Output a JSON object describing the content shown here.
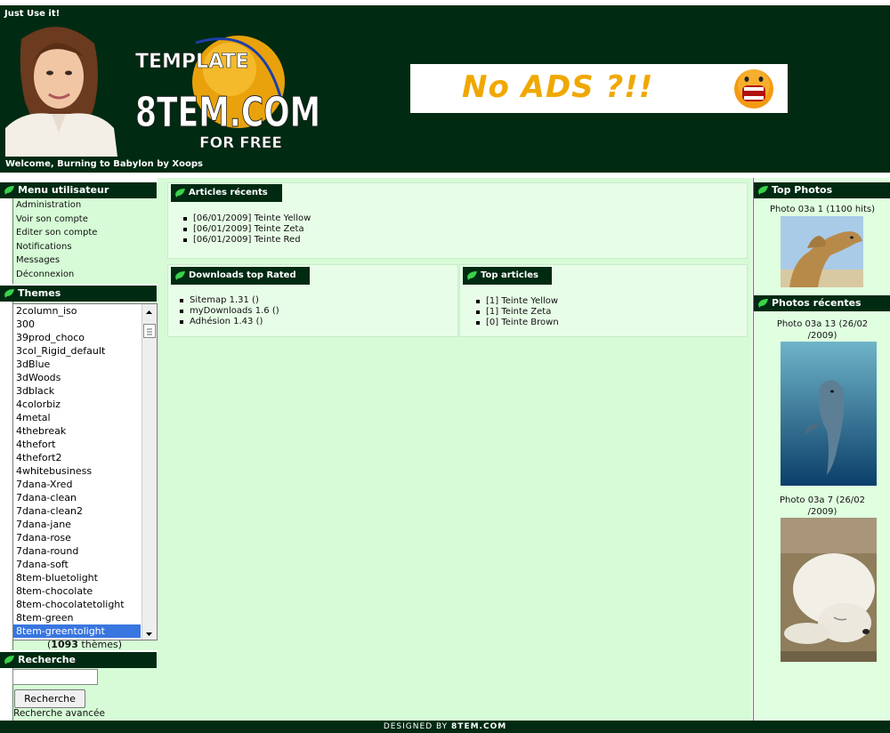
{
  "header": {
    "tagline": "Just Use it!",
    "welcome": "Welcome, Burning to Babylon by Xoops",
    "logo_top": "TEMPLATE",
    "logo_main": "8TEM.COM",
    "logo_bottom": "FOR FREE",
    "ad_text": "No ADS ?!!"
  },
  "left": {
    "menu_title": "Menu utilisateur",
    "menu_items": [
      "Administration",
      "Voir son compte",
      "Editer son compte",
      "Notifications",
      "Messages",
      "Déconnexion"
    ],
    "themes_title": "Themes",
    "themes": [
      "2column_iso",
      "300",
      "39prod_choco",
      "3col_Rigid_default",
      "3dBlue",
      "3dWoods",
      "3dblack",
      "4colorbiz",
      "4metal",
      "4thebreak",
      "4thefort",
      "4thefort2",
      "4whitebusiness",
      "7dana-Xred",
      "7dana-clean",
      "7dana-clean2",
      "7dana-jane",
      "7dana-rose",
      "7dana-round",
      "7dana-soft",
      "8tem-bluetolight",
      "8tem-chocolate",
      "8tem-chocolatetolight",
      "8tem-green",
      "8tem-greentolight"
    ],
    "themes_count_open": "(",
    "themes_count": "1093",
    "themes_count_label": "thèmes)",
    "search_title": "Recherche",
    "search_button": "Recherche",
    "search_advanced": "Recherche avancée",
    "search_value": ""
  },
  "center": {
    "articles_title": "Articles récents",
    "articles": [
      "[06/01/2009] Teinte Yellow",
      "[06/01/2009] Teinte Zeta",
      "[06/01/2009] Teinte Red"
    ],
    "downloads_title": "Downloads top Rated",
    "downloads": [
      "Sitemap 1.31 ()",
      "myDownloads 1.6 ()",
      "Adhésion 1.43 ()"
    ],
    "top_articles_title": "Top articles",
    "top_articles": [
      "[1] Teinte Yellow",
      "[1] Teinte Zeta",
      "[0] Teinte Brown"
    ]
  },
  "right": {
    "top_photos_title": "Top Photos",
    "top_photo_caption": "Photo 03a 1 (1100 hits)",
    "recent_title": "Photos récentes",
    "recent_1_caption_l1": "Photo 03a 13 (26/02",
    "recent_1_caption_l2": "/2009)",
    "recent_2_caption_l1": "Photo 03a 7 (26/02",
    "recent_2_caption_l2": "/2009)"
  },
  "footer": {
    "prefix": "DESIGNED BY",
    "brand": "8TEM.COM"
  },
  "colors": {
    "header": "#002a12",
    "content": "#d6fbd6",
    "leaf": "#3bd24a",
    "selection": "#3876e0"
  }
}
